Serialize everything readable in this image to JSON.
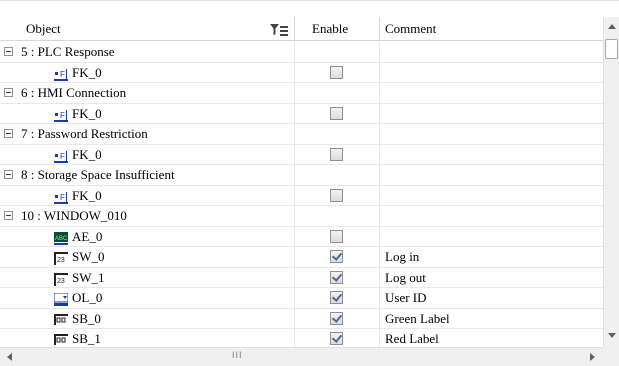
{
  "header": {
    "object": "Object",
    "enable": "Enable",
    "comment": "Comment",
    "filter_icon": "filter-icon"
  },
  "rows": [
    {
      "type": "group",
      "label": "5 : PLC Response"
    },
    {
      "type": "child",
      "icon": "function-key-icon",
      "label": "FK_0",
      "enabled": false,
      "comment": ""
    },
    {
      "type": "group",
      "label": "6 : HMI Connection"
    },
    {
      "type": "child",
      "icon": "function-key-icon",
      "label": "FK_0",
      "enabled": false,
      "comment": ""
    },
    {
      "type": "group",
      "label": "7 : Password Restriction"
    },
    {
      "type": "child",
      "icon": "function-key-icon",
      "label": "FK_0",
      "enabled": false,
      "comment": ""
    },
    {
      "type": "group",
      "label": "8 : Storage Space Insufficient"
    },
    {
      "type": "child",
      "icon": "function-key-icon",
      "label": "FK_0",
      "enabled": false,
      "comment": ""
    },
    {
      "type": "group",
      "label": "10 : WINDOW_010"
    },
    {
      "type": "child",
      "icon": "ascii-entry-icon",
      "label": "AE_0",
      "enabled": false,
      "comment": ""
    },
    {
      "type": "child",
      "icon": "switch-icon",
      "label": "SW_0",
      "enabled": true,
      "comment": "Log in"
    },
    {
      "type": "child",
      "icon": "switch-icon",
      "label": "SW_1",
      "enabled": true,
      "comment": "Log out"
    },
    {
      "type": "child",
      "icon": "option-list-icon",
      "label": "OL_0",
      "enabled": true,
      "comment": "User ID"
    },
    {
      "type": "child",
      "icon": "slide-button-icon",
      "label": "SB_0",
      "enabled": true,
      "comment": "Green Label"
    },
    {
      "type": "child",
      "icon": "slide-button-icon",
      "label": "SB_1",
      "enabled": true,
      "comment": "Red Label"
    }
  ],
  "scrollbar": {
    "grip_text": "III"
  },
  "colors": {
    "checkmark": "#4a6a99",
    "gridline": "#e8e8e8"
  }
}
